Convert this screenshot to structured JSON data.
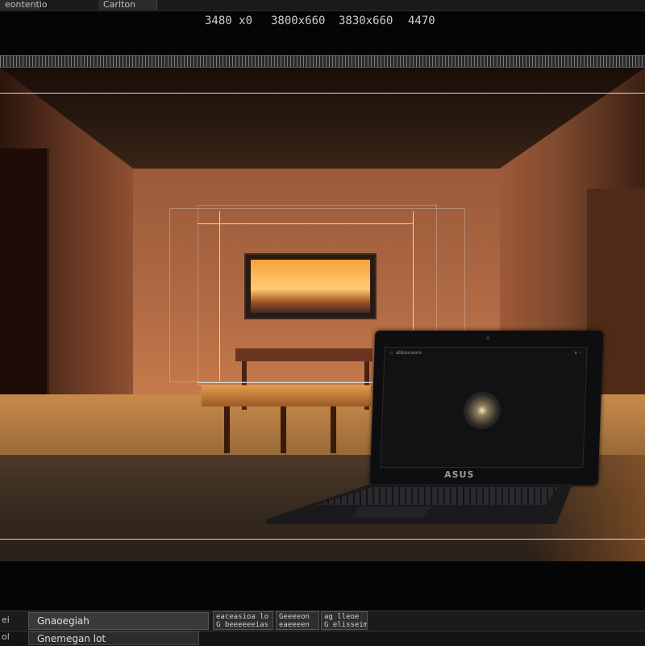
{
  "menu": {
    "tab1": "eontentio",
    "tab2": "Carlton"
  },
  "readouts": [
    "3480  x0",
    "3800x660",
    "3830x660",
    "4470"
  ],
  "screen": {
    "title": "▭ abbasaees",
    "close": "x ◦",
    "brand": "ASUS"
  },
  "bottom": {
    "row1_label": "ei",
    "row1_field": "Gnaoegiah",
    "buttons": [
      "eaceasioa lo\nG beeeeeeias",
      "Geeeeon\neaeeeen",
      "ag lleoe\nG elisseim"
    ],
    "row2_label": "ol",
    "row2_field": "Gnemegan lot"
  },
  "colors": {
    "accent": "#d8d8d8",
    "panel": "#1b1b1b"
  }
}
